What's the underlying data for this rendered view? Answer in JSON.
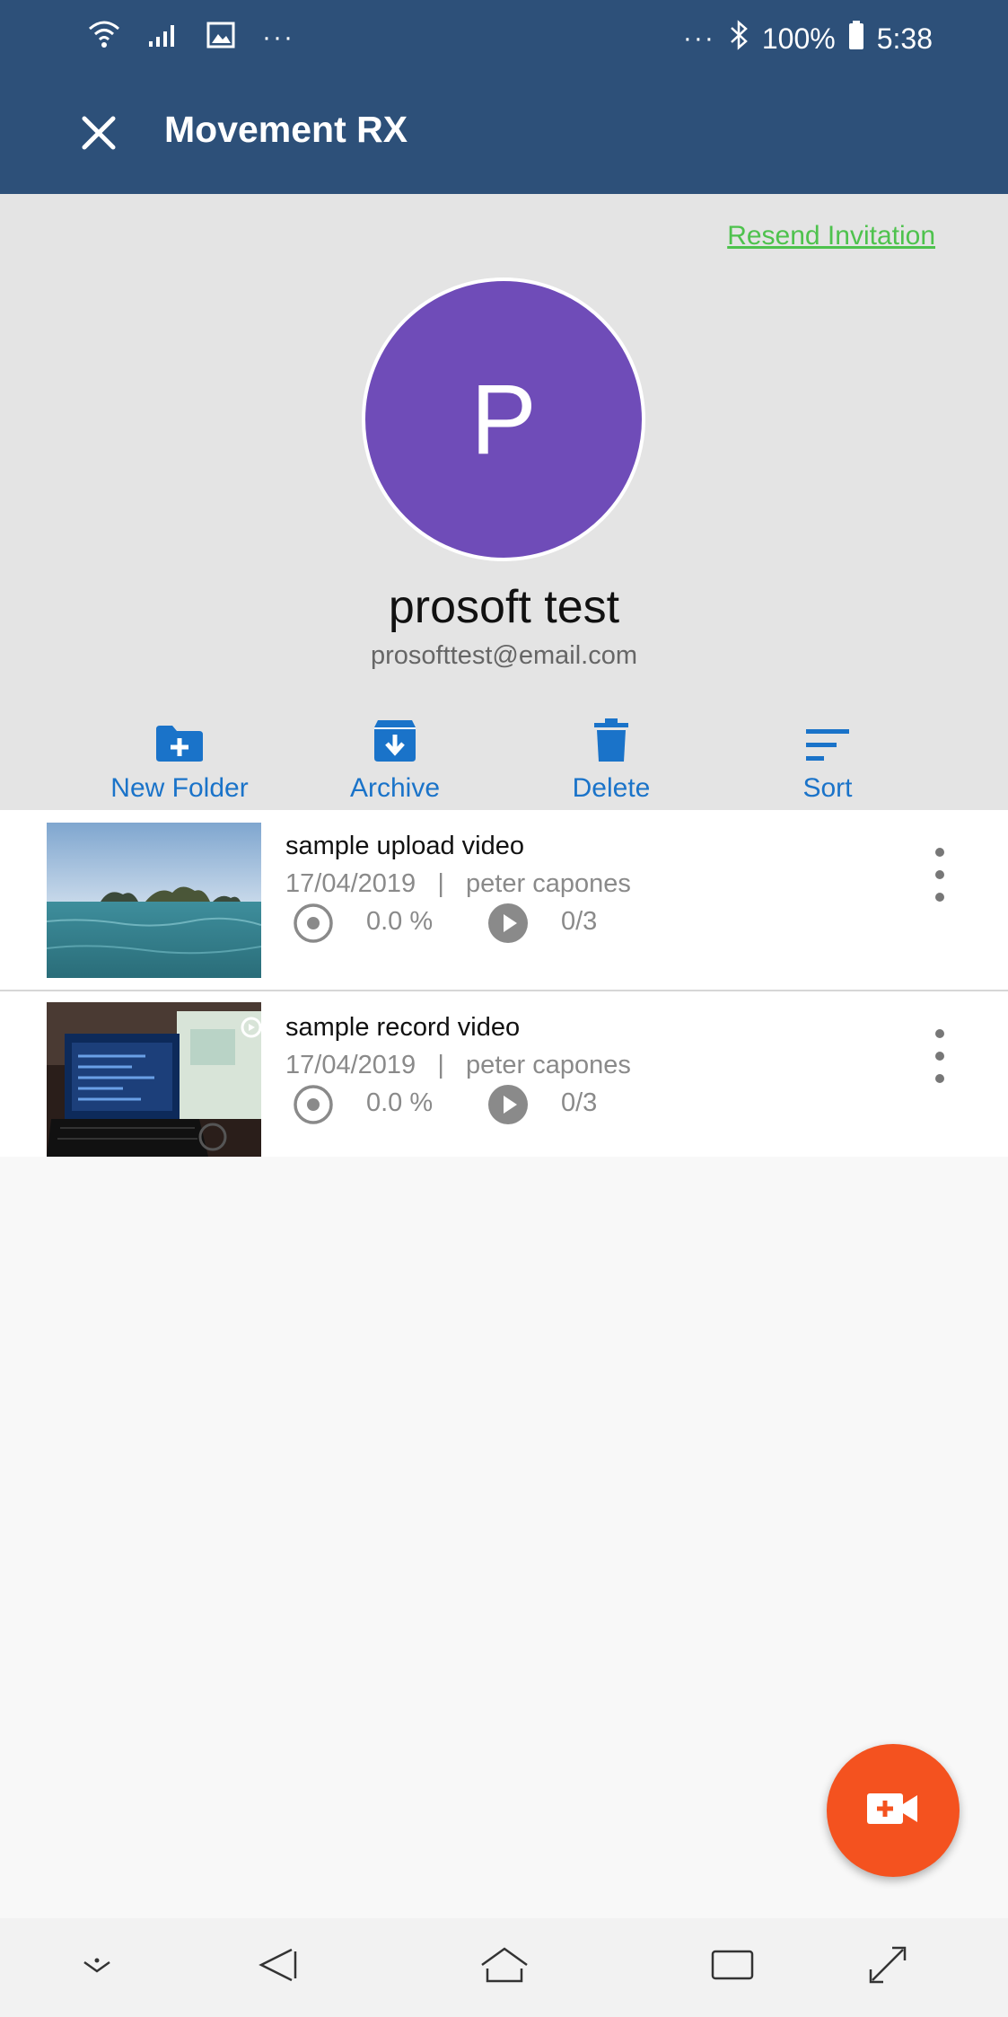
{
  "status_bar": {
    "left_icons": [
      "wifi-icon",
      "signal-icon",
      "image-icon"
    ],
    "left_more": "···",
    "right_more": "···",
    "battery_percent": "100%",
    "time": "5:38"
  },
  "app_bar": {
    "title": "Movement RX",
    "close_icon": "close-icon"
  },
  "profile": {
    "resend_label": "Resend Invitation",
    "avatar_letter": "P",
    "name": "prosoft test",
    "email": "prosofttest@email.com"
  },
  "actions": [
    {
      "label": "New Folder",
      "icon": "new-folder-icon"
    },
    {
      "label": "Archive",
      "icon": "archive-icon"
    },
    {
      "label": "Delete",
      "icon": "delete-icon"
    },
    {
      "label": "Sort",
      "icon": "sort-icon"
    }
  ],
  "videos": [
    {
      "title": "sample upload video",
      "date": "17/04/2019",
      "separator": "|",
      "author": "peter capones",
      "progress": "0.0 %",
      "views": "0/3"
    },
    {
      "title": "sample record video",
      "date": "17/04/2019",
      "separator": "|",
      "author": "peter capones",
      "progress": "0.0 %",
      "views": "0/3"
    }
  ],
  "fab": {
    "icon": "add-video-icon"
  },
  "nav_bar": {
    "icons": [
      "hide-keyboard-icon",
      "back-icon",
      "home-icon",
      "recents-icon",
      "expand-icon"
    ]
  },
  "colors": {
    "primary": "#2d5079",
    "accent_blue": "#1a73c9",
    "link_green": "#4ec24d",
    "avatar": "#6f4cb8",
    "fab": "#f4521f"
  }
}
